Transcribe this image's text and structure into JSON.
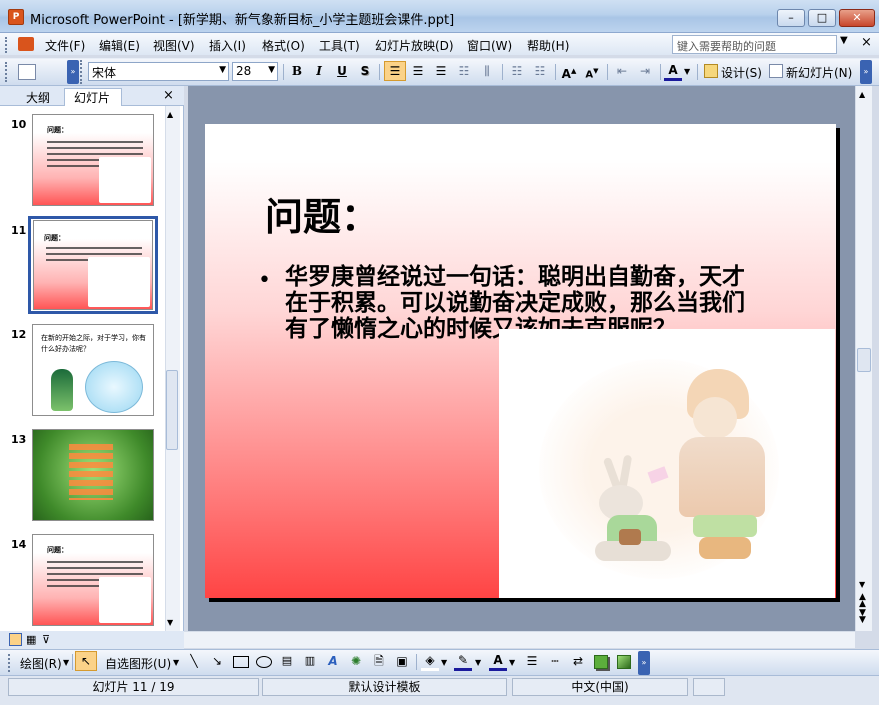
{
  "window": {
    "title": "Microsoft PowerPoint - [新学期、新气象新目标_小学主题班会课件.ppt]",
    "app_badge": "P",
    "minimize": "–",
    "maximize": "□",
    "close": "✕"
  },
  "menu": {
    "items": [
      "文件(F)",
      "编辑(E)",
      "视图(V)",
      "插入(I)",
      "格式(O)",
      "工具(T)",
      "幻灯片放映(D)",
      "窗口(W)",
      "帮助(H)"
    ],
    "help_placeholder": "键入需要帮助的问题",
    "close_doc": "×"
  },
  "toolbar": {
    "font": "宋体",
    "size": "28",
    "bold": "B",
    "italic": "I",
    "underline": "U",
    "shadow": "S",
    "font_color": "A",
    "design_label": "设计(S)",
    "new_slide_label": "新幻灯片(N)"
  },
  "pane": {
    "tabs": [
      "大纲",
      "幻灯片"
    ],
    "close": "×",
    "thumbs": [
      {
        "num": "10",
        "title": "问题："
      },
      {
        "num": "11",
        "title": "问题："
      },
      {
        "num": "12",
        "text": "在新的开始之际，对于学习，你有什么好办法呢？"
      },
      {
        "num": "13"
      },
      {
        "num": "14",
        "title": "问题："
      }
    ]
  },
  "slide": {
    "title": "问题：",
    "bullet": "•",
    "body": "华罗庚曾经说过一句话：聪明出自勤奋，天才在于积累。可以说勤奋决定成败，那么当我们有了懒惰之心的时候又该如去克服呢？"
  },
  "drawbar": {
    "draw": "绘图(R)",
    "autoshapes": "自选图形(U)",
    "font_color": "A"
  },
  "status": {
    "slide": "幻灯片 11 / 19",
    "template": "默认设计模板",
    "language": "中文(中国)"
  }
}
